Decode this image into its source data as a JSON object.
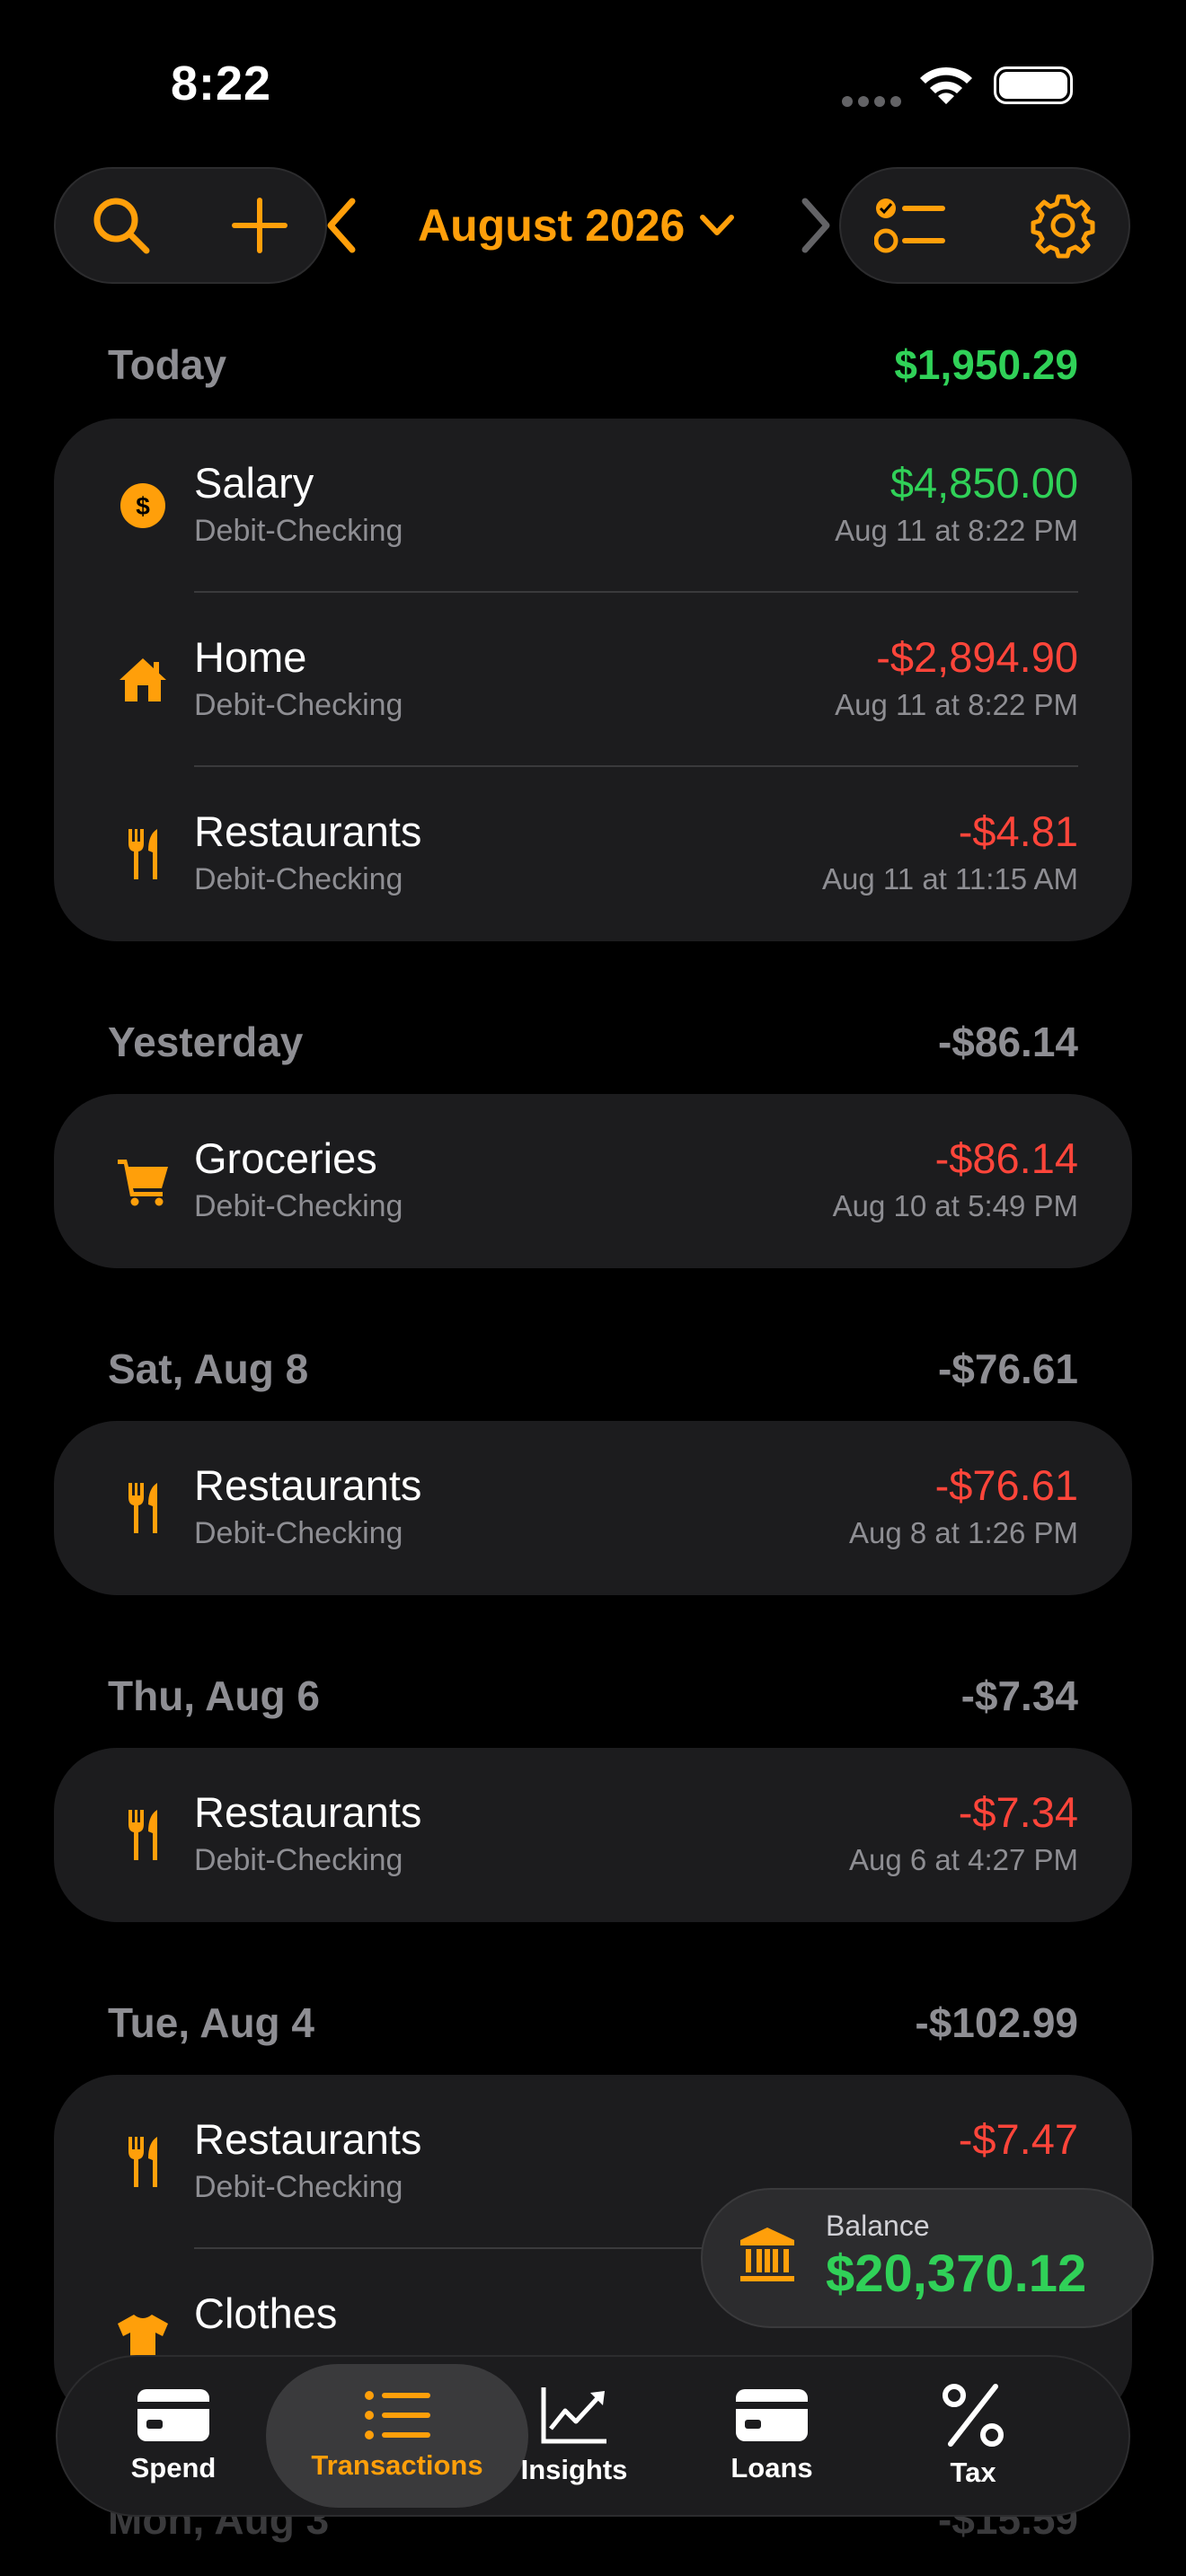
{
  "status": {
    "time": "8:22"
  },
  "header": {
    "month": "August 2026"
  },
  "colors": {
    "accent": "#ff9f0a",
    "positive": "#30d158",
    "negative": "#ff453a",
    "card": "#1c1c1e"
  },
  "sections": [
    {
      "label": "Today",
      "total": "$1,950.29",
      "rows": [
        {
          "icon": "dollar-circle-icon",
          "title": "Salary",
          "account": "Debit-Checking",
          "amount": "$4,850.00",
          "date": "Aug 11 at 8:22 PM"
        },
        {
          "icon": "house-icon",
          "title": "Home",
          "account": "Debit-Checking",
          "amount": "-$2,894.90",
          "date": "Aug 11 at 8:22 PM"
        },
        {
          "icon": "fork-knife-icon",
          "title": "Restaurants",
          "account": "Debit-Checking",
          "amount": "-$4.81",
          "date": "Aug 11 at 11:15 AM"
        }
      ]
    },
    {
      "label": "Yesterday",
      "total": "-$86.14",
      "rows": [
        {
          "icon": "cart-icon",
          "title": "Groceries",
          "account": "Debit-Checking",
          "amount": "-$86.14",
          "date": "Aug 10 at 5:49 PM"
        }
      ]
    },
    {
      "label": "Sat, Aug 8",
      "total": "-$76.61",
      "rows": [
        {
          "icon": "fork-knife-icon",
          "title": "Restaurants",
          "account": "Debit-Checking",
          "amount": "-$76.61",
          "date": "Aug 8 at 1:26 PM"
        }
      ]
    },
    {
      "label": "Thu, Aug 6",
      "total": "-$7.34",
      "rows": [
        {
          "icon": "fork-knife-icon",
          "title": "Restaurants",
          "account": "Debit-Checking",
          "amount": "-$7.34",
          "date": "Aug 6 at 4:27 PM"
        }
      ]
    },
    {
      "label": "Tue, Aug 4",
      "total": "-$102.99",
      "rows": [
        {
          "icon": "fork-knife-icon",
          "title": "Restaurants",
          "account": "Debit-Checking",
          "amount": "-$7.47",
          "date": ""
        },
        {
          "icon": "tshirt-icon",
          "title": "Clothes",
          "account": "",
          "amount": "",
          "date": ""
        }
      ]
    }
  ],
  "peek": {
    "label": "Mon, Aug 3",
    "total": "-$15.59"
  },
  "balance": {
    "label": "Balance",
    "value": "$20,370.12"
  },
  "tabs": {
    "spend": "Spend",
    "transactions": "Transactions",
    "insights": "Insights",
    "loans": "Loans",
    "tax": "Tax"
  }
}
